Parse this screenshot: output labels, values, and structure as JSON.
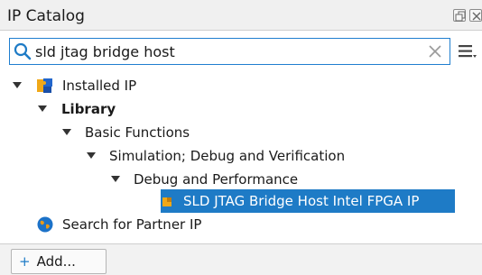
{
  "window": {
    "title": "IP Catalog"
  },
  "search": {
    "value": "sld jtag bridge host"
  },
  "tree": {
    "installed_ip": "Installed IP",
    "library": "Library",
    "basic_functions": "Basic Functions",
    "simulation_debug": "Simulation; Debug and Verification",
    "debug_performance": "Debug and Performance",
    "selected_item": "SLD JTAG Bridge Host Intel FPGA IP",
    "partner_ip": "Search for Partner IP"
  },
  "footer": {
    "add_label": "Add..."
  },
  "colors": {
    "selection": "#1e7bc6",
    "search_border": "#1f7ecf"
  },
  "icons": {
    "search": "search-icon",
    "clear": "clear-icon",
    "menu": "hamburger-menu-icon",
    "installed_ip": "installed-ip-puzzle-icon",
    "ip_core": "ip-core-icon",
    "partner": "globe-icon"
  }
}
